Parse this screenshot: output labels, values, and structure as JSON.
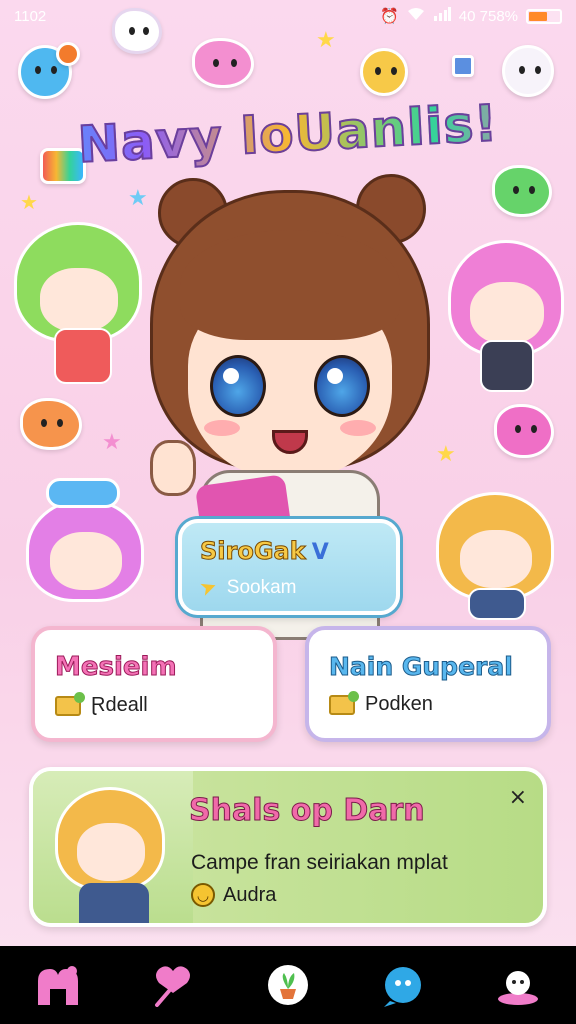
{
  "status_bar": {
    "time": "1102",
    "battery_text": "40 758%"
  },
  "app": {
    "title": "Navy loUanlis!"
  },
  "profile": {
    "name": "SiroGak",
    "verified_mark": "V",
    "subtitle": "Sookam"
  },
  "menu": [
    {
      "title": "Mesieim",
      "item": "Ɽdeall"
    },
    {
      "title": "Nain Guperal",
      "item": "Podken"
    }
  ],
  "banner": {
    "title": "Shals op Darn",
    "body": "Campe fran seiriakan mplat",
    "meta": "Audra",
    "close": "×"
  },
  "nav": [
    {
      "icon": "home-icon"
    },
    {
      "icon": "heart-wand-icon"
    },
    {
      "icon": "plant-icon"
    },
    {
      "icon": "bubble-icon"
    },
    {
      "icon": "profile-icon"
    }
  ],
  "colors": {
    "background": "#f9d0e7",
    "accent_pink": "#f472b6",
    "accent_blue": "#59b7ee",
    "banner_green": "#b7dc86",
    "nav_bg": "#000000"
  }
}
